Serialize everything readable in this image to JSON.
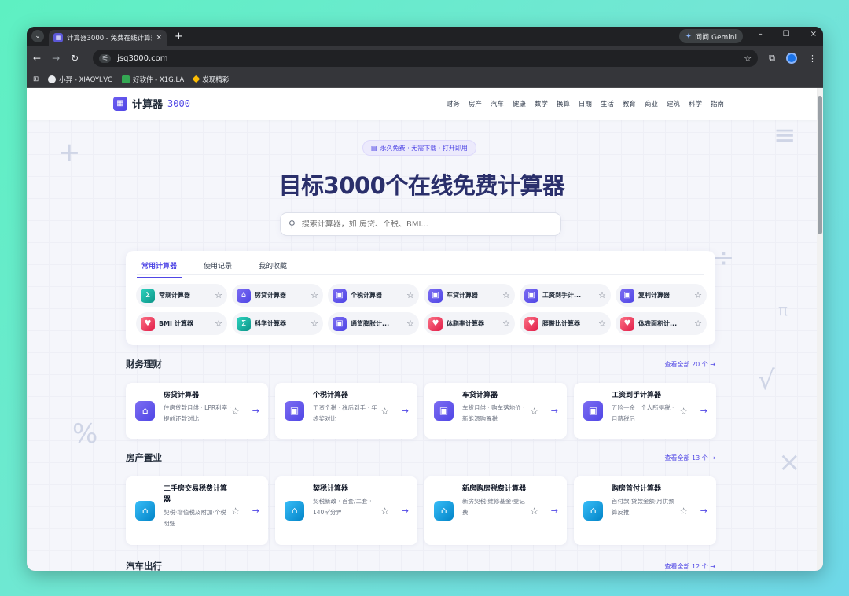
{
  "browser": {
    "tab_title": "计算器3000 - 免费在线计算器",
    "tab_close": "×",
    "new_tab": "+",
    "tabs_menu": "⌄",
    "gemini_label": "问问 Gemini",
    "url": "jsq3000.com",
    "nav_back": "←",
    "nav_forward": "→",
    "nav_reload": "↻",
    "win_min": "–",
    "win_max": "☐",
    "win_close": "×",
    "bookmarks": [
      {
        "label": "小羿 - XIAOYI.VC",
        "color": "#e8eaed"
      },
      {
        "label": "好软件 - X1G.LA",
        "color": "#34a853"
      },
      {
        "label": "发现精彩",
        "color": "#fbbc04"
      }
    ]
  },
  "site": {
    "logo_text": "计算器",
    "logo_num": "3000",
    "nav": [
      "财务",
      "房产",
      "汽车",
      "健康",
      "数学",
      "换算",
      "日期",
      "生活",
      "教育",
      "商业",
      "建筑",
      "科学",
      "指南"
    ],
    "badge": "永久免费 · 无需下载 · 打开即用",
    "hero_title": "目标3000个在线免费计算器",
    "search_placeholder": "搜索计算器，如 房贷、个税、BMI..."
  },
  "panel": {
    "tabs": [
      "常用计算器",
      "使用记录",
      "我的收藏"
    ],
    "chips": [
      {
        "label": "常规计算器",
        "icon": "Σ",
        "grad": "g-teal"
      },
      {
        "label": "房贷计算器",
        "icon": "⌂",
        "grad": "g-purple"
      },
      {
        "label": "个税计算器",
        "icon": "▣",
        "grad": "g-purple"
      },
      {
        "label": "车贷计算器",
        "icon": "▣",
        "grad": "g-purple"
      },
      {
        "label": "工资到手计...",
        "icon": "▣",
        "grad": "g-purple"
      },
      {
        "label": "复利计算器",
        "icon": "▣",
        "grad": "g-purple"
      },
      {
        "label": "BMI 计算器",
        "icon": "♥",
        "grad": "g-red"
      },
      {
        "label": "科学计算器",
        "icon": "Σ",
        "grad": "g-teal"
      },
      {
        "label": "通货膨胀计...",
        "icon": "▣",
        "grad": "g-purple"
      },
      {
        "label": "体脂率计算器",
        "icon": "♥",
        "grad": "g-red"
      },
      {
        "label": "腰臀比计算器",
        "icon": "♥",
        "grad": "g-red"
      },
      {
        "label": "体表面积计...",
        "icon": "♥",
        "grad": "g-red"
      }
    ],
    "star": "☆"
  },
  "sections": [
    {
      "title": "财务理财",
      "link": "查看全部 20 个 →",
      "cards": [
        {
          "title": "房贷计算器",
          "desc": "住房贷款月供 · LPR利率 · 提前还款对比",
          "icon": "⌂",
          "grad": "g-purple"
        },
        {
          "title": "个税计算器",
          "desc": "工资个税 · 税后到手 · 年终奖对比",
          "icon": "▣",
          "grad": "g-purple"
        },
        {
          "title": "车贷计算器",
          "desc": "车贷月供 · 购车落地价 · 新能源购置税",
          "icon": "▣",
          "grad": "g-purple"
        },
        {
          "title": "工资到手计算器",
          "desc": "五险一金 · 个人所得税 · 月薪税后",
          "icon": "▣",
          "grad": "g-purple"
        }
      ]
    },
    {
      "title": "房产置业",
      "link": "查看全部 13 个 →",
      "cards": [
        {
          "title": "二手房交易税费计算器",
          "desc": "契税·增值税及附加·个税明细",
          "icon": "⌂",
          "grad": "g-blue"
        },
        {
          "title": "契税计算器",
          "desc": "契税新政 · 首套/二套 · 140㎡分界",
          "icon": "⌂",
          "grad": "g-blue"
        },
        {
          "title": "新房购房税费计算器",
          "desc": "新房契税·维修基金·登记费",
          "icon": "⌂",
          "grad": "g-blue"
        },
        {
          "title": "购房首付计算器",
          "desc": "首付款·贷款金额·月供预算反推",
          "icon": "⌂",
          "grad": "g-blue"
        }
      ]
    },
    {
      "title": "汽车出行",
      "link": "查看全部 12 个 →",
      "cards": []
    }
  ]
}
